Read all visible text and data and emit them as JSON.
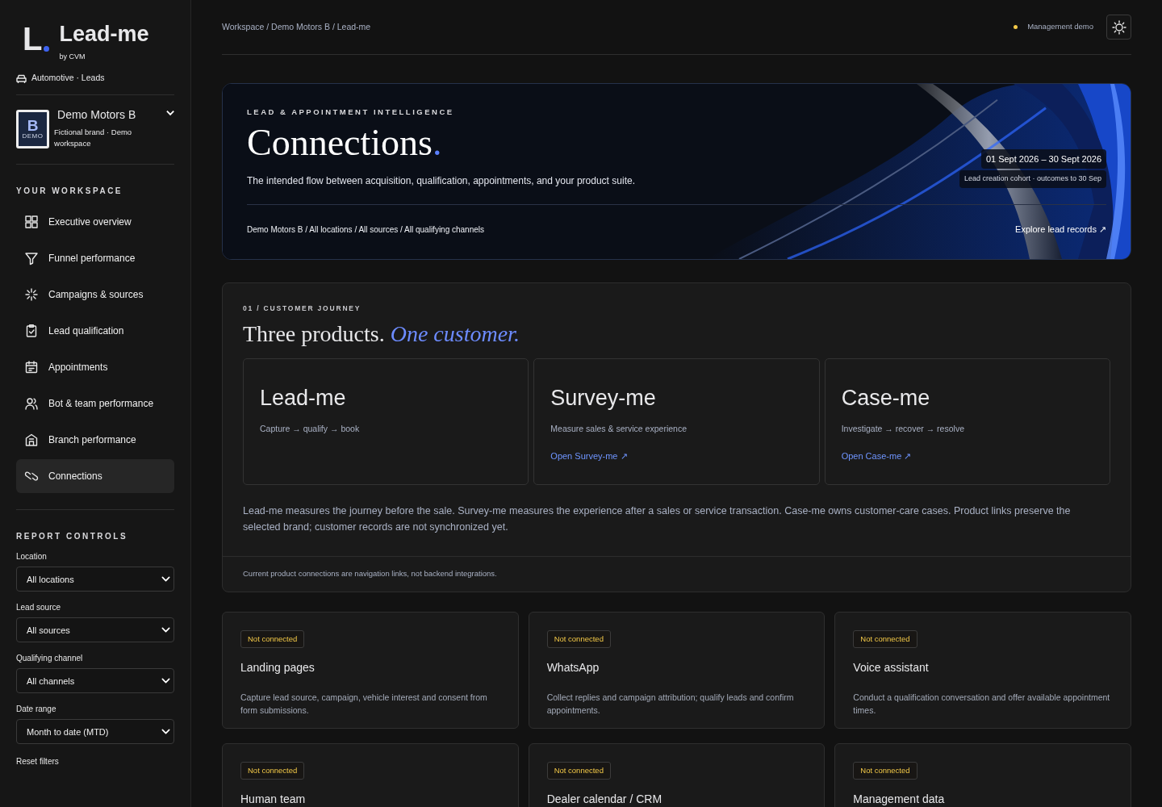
{
  "sidebar": {
    "logo_mark": "L",
    "brand": "Lead-me",
    "brand_by": "by CVM",
    "vertical": "Automotive · Leads",
    "workspace": {
      "avatar_letter": "B",
      "avatar_tag": "DEMO",
      "name": "Demo Motors B",
      "subtitle": "Fictional brand · Demo workspace"
    },
    "nav_heading": "YOUR WORKSPACE",
    "nav_items": [
      {
        "label": "Executive overview",
        "selected": false
      },
      {
        "label": "Funnel performance",
        "selected": false
      },
      {
        "label": "Campaigns & sources",
        "selected": false
      },
      {
        "label": "Lead qualification",
        "selected": false
      },
      {
        "label": "Appointments",
        "selected": false
      },
      {
        "label": "Bot & team performance",
        "selected": false
      },
      {
        "label": "Branch performance",
        "selected": false
      },
      {
        "label": "Connections",
        "selected": true
      }
    ],
    "controls_heading": "REPORT CONTROLS",
    "filters": [
      {
        "label": "Location",
        "value": "All locations"
      },
      {
        "label": "Lead source",
        "value": "All sources"
      },
      {
        "label": "Qualifying channel",
        "value": "All channels"
      },
      {
        "label": "Date range",
        "value": "Month to date (MTD)"
      }
    ],
    "reset": "Reset filters"
  },
  "topbar": {
    "breadcrumb": "Workspace / Demo Motors B / Lead-me",
    "status": "Management demo"
  },
  "hero": {
    "eyebrow": "LEAD & APPOINTMENT INTELLIGENCE",
    "title": "Connections",
    "title_accent": ".",
    "description": "The intended flow between acquisition, qualification, appointments, and your product suite.",
    "period": "01 Sept 2026 – 30 Sept 2026",
    "period_note": "Lead creation cohort · outcomes to 30 Sep",
    "scope": "Demo Motors B / All locations / All sources / All qualifying channels",
    "link": "Explore lead records ↗"
  },
  "journey": {
    "eyebrow": "01 / CUSTOMER JOURNEY",
    "heading": "Three products. *One customer.*",
    "products": [
      {
        "name": "Lead-me",
        "tagline": "Capture → qualify → book"
      },
      {
        "name": "Survey-me",
        "tagline": "Measure sales & service experience",
        "link": "Open Survey-me ↗"
      },
      {
        "name": "Case-me",
        "tagline": "Investigate → recover → resolve",
        "link": "Open Case-me ↗"
      }
    ],
    "description": "Lead-me measures the journey before the sale. Survey-me measures the experience after a sales or service transaction. Case-me owns customer-care cases. Product links preserve the selected brand; customer records are not synchronized yet.",
    "footnote": "Current product connections are navigation links, not backend integrations."
  },
  "integrations": [
    {
      "status": "Not connected",
      "title": "Landing pages",
      "description": "Capture lead source, campaign, vehicle interest and consent from form submissions."
    },
    {
      "status": "Not connected",
      "title": "WhatsApp",
      "description": "Collect replies and campaign attribution; qualify leads and confirm appointments."
    },
    {
      "status": "Not connected",
      "title": "Voice assistant",
      "description": "Conduct a qualification conversation and offer available appointment times."
    },
    {
      "status": "Not connected",
      "title": "Human team"
    },
    {
      "status": "Not connected",
      "title": "Dealer calendar / CRM"
    },
    {
      "status": "Not connected",
      "title": "Management data"
    }
  ]
}
